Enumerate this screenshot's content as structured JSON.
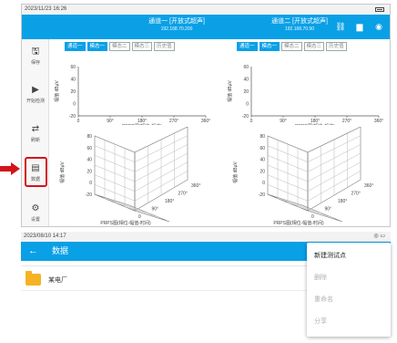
{
  "shot1": {
    "status_time": "2023/11/23 16:26",
    "channels": [
      {
        "title": "通道一 [开放式超声]",
        "ip": "192.168.70.200"
      },
      {
        "title": "通道二 [开放式超声]",
        "ip": "192.168.70.90"
      }
    ],
    "top_icons": [
      "link-icon",
      "camera-icon",
      "wireless-icon"
    ],
    "sidebar": [
      {
        "icon": "save-icon",
        "glyph": "🖫",
        "label": "保存"
      },
      {
        "icon": "play-icon",
        "glyph": "▶",
        "label": "开始检测"
      },
      {
        "icon": "refresh-icon",
        "glyph": "⇄",
        "label": "刷新"
      },
      {
        "icon": "data-icon",
        "glyph": "▤",
        "label": "数据"
      },
      {
        "icon": "settings-icon",
        "glyph": "⚙",
        "label": "设置"
      }
    ],
    "tabs": [
      "通道一",
      "模态一",
      "模态二",
      "模态三",
      "历史值"
    ],
    "chart2d": {
      "ylabel": "幅值 dBμV",
      "xlabel": "PRPD图(相位-幅值)",
      "yticks": [
        "60",
        "40",
        "20",
        "0",
        "-20"
      ],
      "xticks": [
        "0",
        "90°",
        "180°",
        "270°",
        "360°"
      ]
    },
    "chart3d": {
      "ylabel": "幅值 dBμV",
      "xlabel": "PRPS图(相位-幅值-时间)",
      "zticks": [
        "80",
        "60",
        "40",
        "20",
        "0",
        "-20"
      ],
      "phase_ticks": [
        "0",
        "90°",
        "180°",
        "270°",
        "360°"
      ]
    }
  },
  "shot2": {
    "status_time": "2023/08/10 14:17",
    "status_icons": "◎ ▭",
    "title": "数据",
    "back_icon": "arrow-left-icon",
    "items": [
      {
        "label": "某电厂"
      }
    ],
    "menu": [
      {
        "label": "新建测试点",
        "enabled": true
      },
      {
        "label": "删除",
        "enabled": false
      },
      {
        "label": "重命名",
        "enabled": false
      },
      {
        "label": "分享",
        "enabled": false
      }
    ]
  },
  "colors": {
    "accent": "#0aa0e6",
    "highlight": "#d2141a",
    "folder": "#f5b324"
  }
}
